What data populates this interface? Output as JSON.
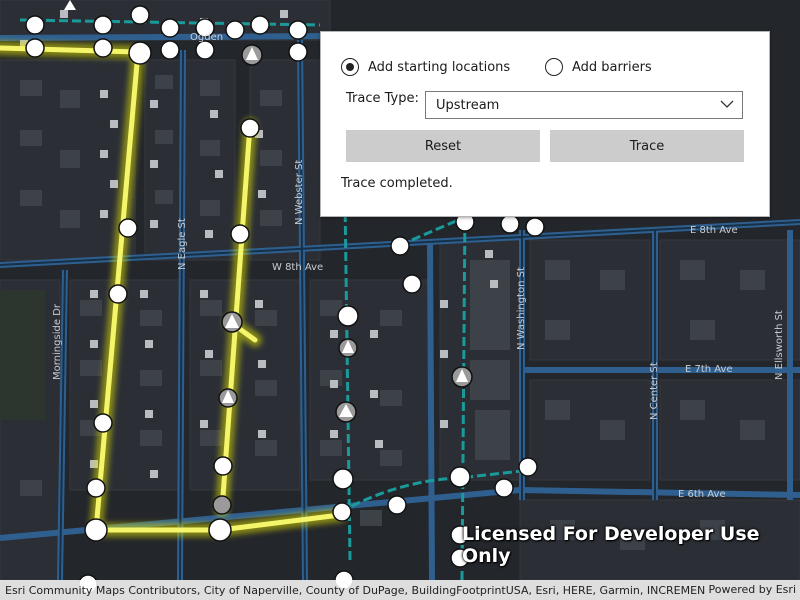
{
  "panel": {
    "radio_start_label": "Add starting locations",
    "radio_barrier_label": "Add barriers",
    "trace_type_label": "Trace Type:",
    "trace_type_value": "Upstream",
    "reset_label": "Reset",
    "trace_label": "Trace",
    "status_text": "Trace completed."
  },
  "map": {
    "street_labels": [
      "E 8th Ave",
      "W 8th Ave",
      "E 7th Ave",
      "E 6th Ave",
      "N Eagle St",
      "N Webster St",
      "N Washington St",
      "Morningside Dr",
      "N Center St",
      "N Ellsworth St",
      "Ogden"
    ],
    "watermark": "Licensed For Developer Use Only",
    "attribution": "Esri Community Maps Contributors, City of Naperville, County of DuPage, BuildingFootprintUSA, Esri, HERE, Garmin, INCREMENT P,...",
    "powered_by": "Powered by Esri"
  },
  "icons": {
    "radio_selected": "radio-selected-icon",
    "radio_unselected": "radio-unselected-icon",
    "dropdown": "chevron-down-icon"
  }
}
